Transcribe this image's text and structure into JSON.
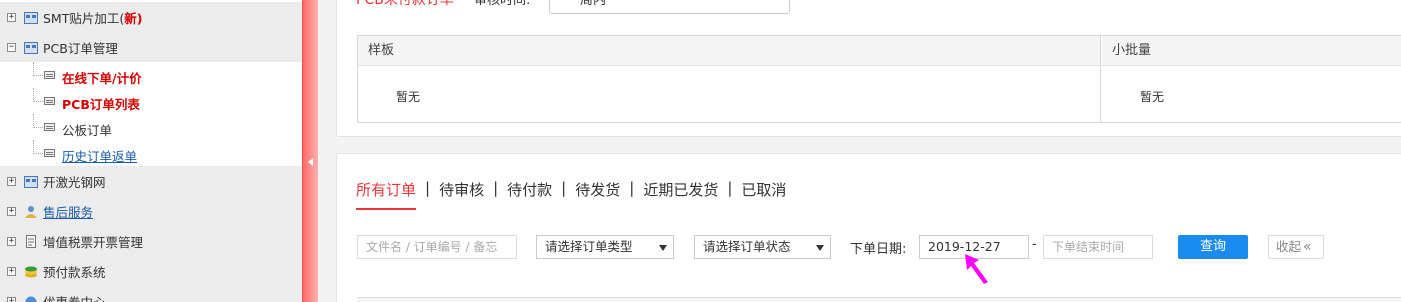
{
  "sidebar": {
    "items": [
      {
        "label": "SMT贴片加工(",
        "extra": "新)",
        "toggle": "+"
      },
      {
        "label": "PCB订单管理",
        "toggle": "−"
      },
      {
        "label": "开激光钢网",
        "toggle": "+"
      },
      {
        "label": "售后服务",
        "toggle": "+"
      },
      {
        "label": "增值税票开票管理",
        "toggle": "+"
      },
      {
        "label": "预付款系统",
        "toggle": "+"
      },
      {
        "label": "优惠券中心",
        "toggle": "+"
      }
    ],
    "sub_items": [
      {
        "label": "在线下单/计价"
      },
      {
        "label": "PCB订单列表"
      },
      {
        "label": "公板订单"
      },
      {
        "label": "历史订单返单"
      }
    ]
  },
  "top_panel": {
    "title": "PCB未付款订单",
    "audit_label": "审核时间:",
    "audit_value": "周内"
  },
  "table": {
    "col1_header": "样板",
    "col1_empty": "暂无",
    "col2_header": "小批量",
    "col2_empty": "暂无"
  },
  "tabs": [
    {
      "label": "所有订单"
    },
    {
      "label": "待审核"
    },
    {
      "label": "待付款"
    },
    {
      "label": "待发货"
    },
    {
      "label": "近期已发货"
    },
    {
      "label": "已取消"
    }
  ],
  "tab_separator": "|",
  "filters": {
    "search_placeholder": "文件名 / 订单编号 / 备忘",
    "order_type_select": "请选择订单类型",
    "order_status_select": "请选择订单状态",
    "date_label": "下单日期:",
    "date_start": "2019-12-27",
    "date_dash": "-",
    "date_end_placeholder": "下单结束时间",
    "query_button": "查询",
    "collapse_button": "收起",
    "collapse_icon": "«"
  },
  "colors": {
    "accent": "#e4393c",
    "primary_button": "#1a8cf0",
    "pointer": "#ff00ff"
  }
}
